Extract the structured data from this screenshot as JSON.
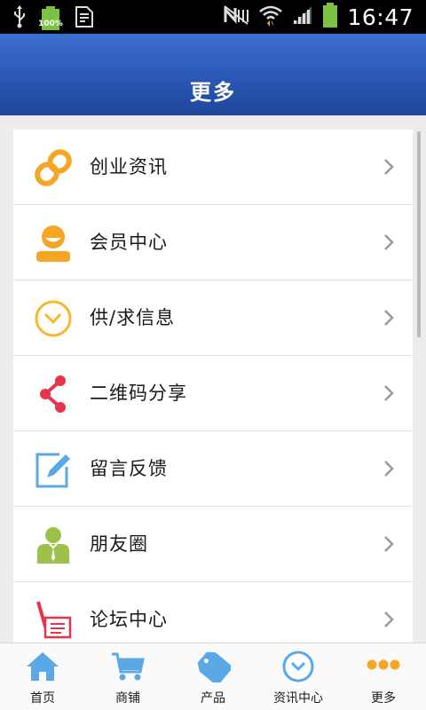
{
  "status_bar": {
    "battery_percent_label": "100%",
    "time": "16:47"
  },
  "header": {
    "title": "更多"
  },
  "menu": {
    "items": [
      {
        "label": "创业资讯",
        "icon": "link-chain-icon"
      },
      {
        "label": "会员中心",
        "icon": "member-person-icon"
      },
      {
        "label": "供/求信息",
        "icon": "clock-icon"
      },
      {
        "label": "二维码分享",
        "icon": "share-icon"
      },
      {
        "label": "留言反馈",
        "icon": "edit-note-icon"
      },
      {
        "label": "朋友圈",
        "icon": "friend-person-icon"
      },
      {
        "label": "论坛中心",
        "icon": "forum-pen-icon"
      }
    ]
  },
  "tabbar": {
    "tabs": [
      {
        "label": "首页",
        "icon": "home-icon"
      },
      {
        "label": "商铺",
        "icon": "cart-icon"
      },
      {
        "label": "产品",
        "icon": "sale-tag-icon"
      },
      {
        "label": "资讯中心",
        "icon": "clock-icon"
      },
      {
        "label": "更多",
        "icon": "more-dots-icon"
      }
    ]
  },
  "colors": {
    "header_blue": "#2b57b5",
    "orange": "#f5a623",
    "red": "#e8344a",
    "light_blue": "#5aa9e6",
    "green": "#9cc24a"
  }
}
